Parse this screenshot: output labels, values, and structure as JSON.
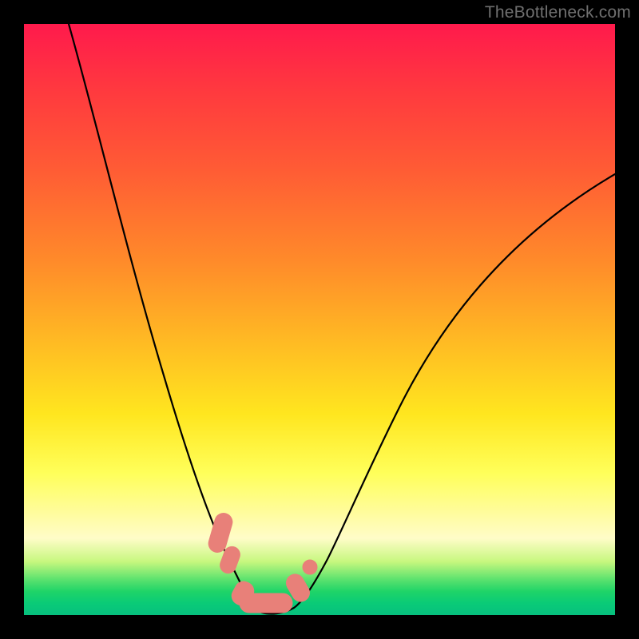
{
  "watermark": "TheBottleneck.com",
  "colors": {
    "frame": "#000000",
    "gradient_top": "#ff1a4c",
    "gradient_bottom": "#07c07e",
    "curve": "#000000",
    "marker": "#e88079"
  },
  "chart_data": {
    "type": "line",
    "title": "",
    "xlabel": "",
    "ylabel": "",
    "xlim": [
      0,
      100
    ],
    "ylim": [
      0,
      100
    ],
    "x": [
      0,
      5,
      10,
      15,
      20,
      25,
      30,
      33,
      35,
      37,
      40,
      42,
      45,
      50,
      55,
      60,
      65,
      70,
      75,
      80,
      85,
      90,
      95,
      100
    ],
    "series": [
      {
        "name": "bottleneck-curve",
        "values": [
          112,
          97,
          82,
          67,
          53,
          40,
          27,
          18,
          12,
          7,
          3,
          1,
          1,
          4,
          10,
          18,
          27,
          36,
          45,
          53,
          60,
          66,
          71,
          75
        ]
      }
    ],
    "markers": [
      {
        "x": 33.5,
        "y": 13,
        "shape": "capsule-vertical"
      },
      {
        "x": 40.5,
        "y": 1.3,
        "shape": "capsule-horizontal"
      },
      {
        "x": 46.5,
        "y": 7,
        "shape": "capsule-diagonal"
      }
    ],
    "notes": "Background is a vertical red→green gradient; curve is a V-shaped black line with pink lozenge markers near the minimum. Axes are unlabeled; values are read in 0–100 percent of plot area."
  }
}
